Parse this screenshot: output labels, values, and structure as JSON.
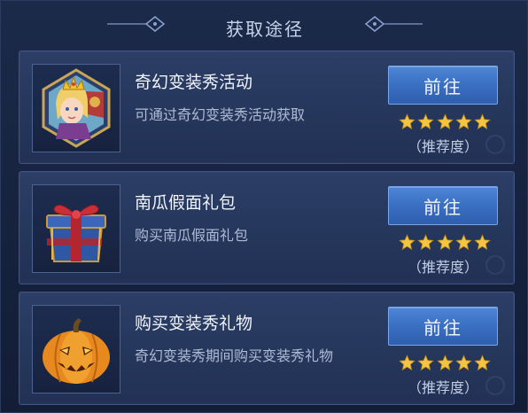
{
  "header": {
    "title": "获取途径"
  },
  "items": [
    {
      "title": "奇幻变装秀活动",
      "desc": "可通过奇幻变装秀活动获取",
      "button_label": "前往",
      "rating": 5,
      "rating_label": "（推荐度）",
      "icon": "hero-portrait-icon"
    },
    {
      "title": "南瓜假面礼包",
      "desc": "购买南瓜假面礼包",
      "button_label": "前往",
      "rating": 5,
      "rating_label": "（推荐度）",
      "icon": "gift-box-icon"
    },
    {
      "title": "购买变装秀礼物",
      "desc": "奇幻变装秀期间购买变装秀礼物",
      "button_label": "前往",
      "rating": 5,
      "rating_label": "（推荐度）",
      "icon": "pumpkin-icon"
    }
  ],
  "colors": {
    "accent_button": "#3a6fc2",
    "star": "#f5c542",
    "panel_bg": "#1c2a4a"
  }
}
